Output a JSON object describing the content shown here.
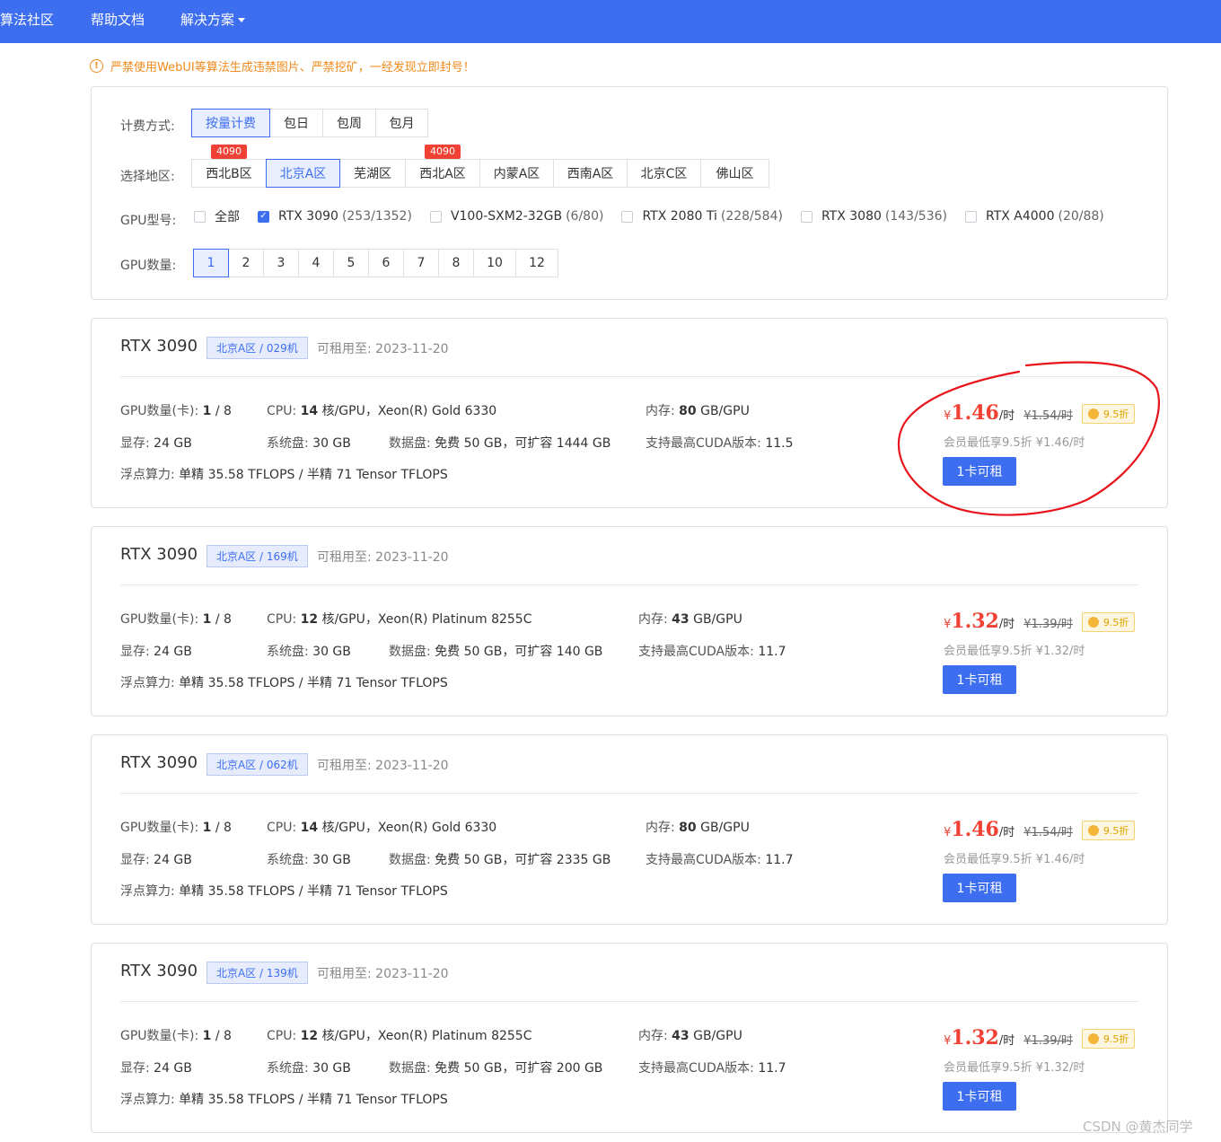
{
  "nav": {
    "items": [
      "算法社区",
      "帮助文档",
      "解决方案"
    ]
  },
  "warning": "严禁使用WebUI等算法生成违禁图片、严禁挖矿，一经发现立即封号！",
  "filter": {
    "billing_label": "计费方式:",
    "billing_options": [
      "按量计费",
      "包日",
      "包周",
      "包月"
    ],
    "region_label": "选择地区:",
    "regions": [
      {
        "label": "西北B区",
        "tag": "4090"
      },
      {
        "label": "北京A区",
        "tag": ""
      },
      {
        "label": "芜湖区",
        "tag": ""
      },
      {
        "label": "西北A区",
        "tag": "4090"
      },
      {
        "label": "内蒙A区",
        "tag": ""
      },
      {
        "label": "西南A区",
        "tag": ""
      },
      {
        "label": "北京C区",
        "tag": ""
      },
      {
        "label": "佛山区",
        "tag": ""
      }
    ],
    "gpu_type_label": "GPU型号:",
    "gpu_types": [
      {
        "label": "全部",
        "count": "",
        "checked": false
      },
      {
        "label": "RTX 3090",
        "count": "(253/1352)",
        "checked": true
      },
      {
        "label": "V100-SXM2-32GB",
        "count": "(6/80)",
        "checked": false
      },
      {
        "label": "RTX 2080 Ti",
        "count": "(228/584)",
        "checked": false
      },
      {
        "label": "RTX 3080",
        "count": "(143/536)",
        "checked": false
      },
      {
        "label": "RTX A4000",
        "count": "(20/88)",
        "checked": false
      }
    ],
    "gpu_count_label": "GPU数量:",
    "gpu_counts": [
      "1",
      "2",
      "3",
      "4",
      "5",
      "6",
      "7",
      "8",
      "10",
      "12"
    ]
  },
  "labels": {
    "avail_prefix": "可租用至:",
    "gpu_count": "GPU数量(卡):",
    "cpu": "CPU:",
    "mem": "内存:",
    "vram": "显存:",
    "sysdisk": "系统盘:",
    "datadisk": "数据盘:",
    "cuda": "支持最高CUDA版本:",
    "flops": "浮点算力:",
    "rent_button": "1卡可租"
  },
  "cards": [
    {
      "title": "RTX 3090",
      "location": "北京A区 / 029机",
      "avail": "2023-11-20",
      "gpu_free": "1",
      "gpu_total": " / 8",
      "cpu_cores": "14",
      "cpu_model": " 核/GPU，Xeon(R) Gold 6330",
      "mem_val": "80",
      "mem_unit": " GB/GPU",
      "vram": "24 GB",
      "sysdisk": "30 GB",
      "datadisk": "免费 50 GB，可扩容 1444 GB",
      "cuda": "11.5",
      "flops": "单精 35.58 TFLOPS / 半精 71 Tensor TFLOPS",
      "price_yen": "¥",
      "price": "1.46",
      "price_unit": "/时",
      "orig_price": "¥1.54/时",
      "discount": "9.5折",
      "member_text": "会员最低享9.5折 ¥1.46/时"
    },
    {
      "title": "RTX 3090",
      "location": "北京A区 / 169机",
      "avail": "2023-11-20",
      "gpu_free": "1",
      "gpu_total": " / 8",
      "cpu_cores": "12",
      "cpu_model": " 核/GPU，Xeon(R) Platinum 8255C",
      "mem_val": "43",
      "mem_unit": " GB/GPU",
      "vram": "24 GB",
      "sysdisk": "30 GB",
      "datadisk": "免费 50 GB，可扩容 140 GB",
      "cuda": "11.7",
      "flops": "单精 35.58 TFLOPS / 半精 71 Tensor TFLOPS",
      "price_yen": "¥",
      "price": "1.32",
      "price_unit": "/时",
      "orig_price": "¥1.39/时",
      "discount": "9.5折",
      "member_text": "会员最低享9.5折 ¥1.32/时"
    },
    {
      "title": "RTX 3090",
      "location": "北京A区 / 062机",
      "avail": "2023-11-20",
      "gpu_free": "1",
      "gpu_total": " / 8",
      "cpu_cores": "14",
      "cpu_model": " 核/GPU，Xeon(R) Gold 6330",
      "mem_val": "80",
      "mem_unit": " GB/GPU",
      "vram": "24 GB",
      "sysdisk": "30 GB",
      "datadisk": "免费 50 GB，可扩容 2335 GB",
      "cuda": "11.7",
      "flops": "单精 35.58 TFLOPS / 半精 71 Tensor TFLOPS",
      "price_yen": "¥",
      "price": "1.46",
      "price_unit": "/时",
      "orig_price": "¥1.54/时",
      "discount": "9.5折",
      "member_text": "会员最低享9.5折 ¥1.46/时"
    },
    {
      "title": "RTX 3090",
      "location": "北京A区 / 139机",
      "avail": "2023-11-20",
      "gpu_free": "1",
      "gpu_total": " / 8",
      "cpu_cores": "12",
      "cpu_model": " 核/GPU，Xeon(R) Platinum 8255C",
      "mem_val": "43",
      "mem_unit": " GB/GPU",
      "vram": "24 GB",
      "sysdisk": "30 GB",
      "datadisk": "免费 50 GB，可扩容 200 GB",
      "cuda": "11.7",
      "flops": "单精 35.58 TFLOPS / 半精 71 Tensor TFLOPS",
      "price_yen": "¥",
      "price": "1.32",
      "price_unit": "/时",
      "orig_price": "¥1.39/时",
      "discount": "9.5折",
      "member_text": "会员最低享9.5折 ¥1.32/时"
    }
  ],
  "watermark": "CSDN @黄杰同学",
  "colors": {
    "accent": "#3d6ef0",
    "price_red": "#f04134",
    "warning": "#f08a1c",
    "annotation": "#e8141c"
  }
}
